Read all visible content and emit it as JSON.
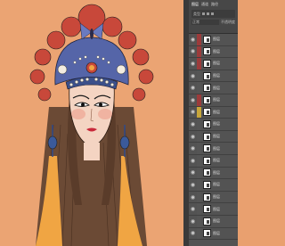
{
  "panel": {
    "tabs": [
      "图层",
      "通道",
      "路径"
    ],
    "filter_kind": "类型",
    "blend_mode": "正常",
    "opacity_label": "不透明度"
  },
  "layers": [
    {
      "name": "图层",
      "color": "#9c3b3b"
    },
    {
      "name": "图层",
      "color": "#9c3b3b"
    },
    {
      "name": "图层",
      "color": "#9c3b3b"
    },
    {
      "name": "图层",
      "color": "#555555"
    },
    {
      "name": "图层",
      "color": "#555555"
    },
    {
      "name": "图层",
      "color": "#9c3b3b"
    },
    {
      "name": "图层",
      "color": "#c7a63a"
    },
    {
      "name": "图层",
      "color": "#555555"
    },
    {
      "name": "图层",
      "color": "#555555"
    },
    {
      "name": "图层",
      "color": "#555555"
    },
    {
      "name": "图层",
      "color": "#555555"
    },
    {
      "name": "图层",
      "color": "#555555"
    },
    {
      "name": "图层",
      "color": "#555555"
    },
    {
      "name": "图层",
      "color": "#555555"
    },
    {
      "name": "图层",
      "color": "#555555"
    },
    {
      "name": "图层",
      "color": "#555555"
    },
    {
      "name": "图层",
      "color": "#555555"
    }
  ],
  "colors": {
    "background": "#eba473",
    "headdress_red": "#c8483a",
    "headdress_blue": "#5565a8",
    "hair": "#6b4a35",
    "skin": "#f4d4c2",
    "tassel_orange": "#f0a543"
  }
}
